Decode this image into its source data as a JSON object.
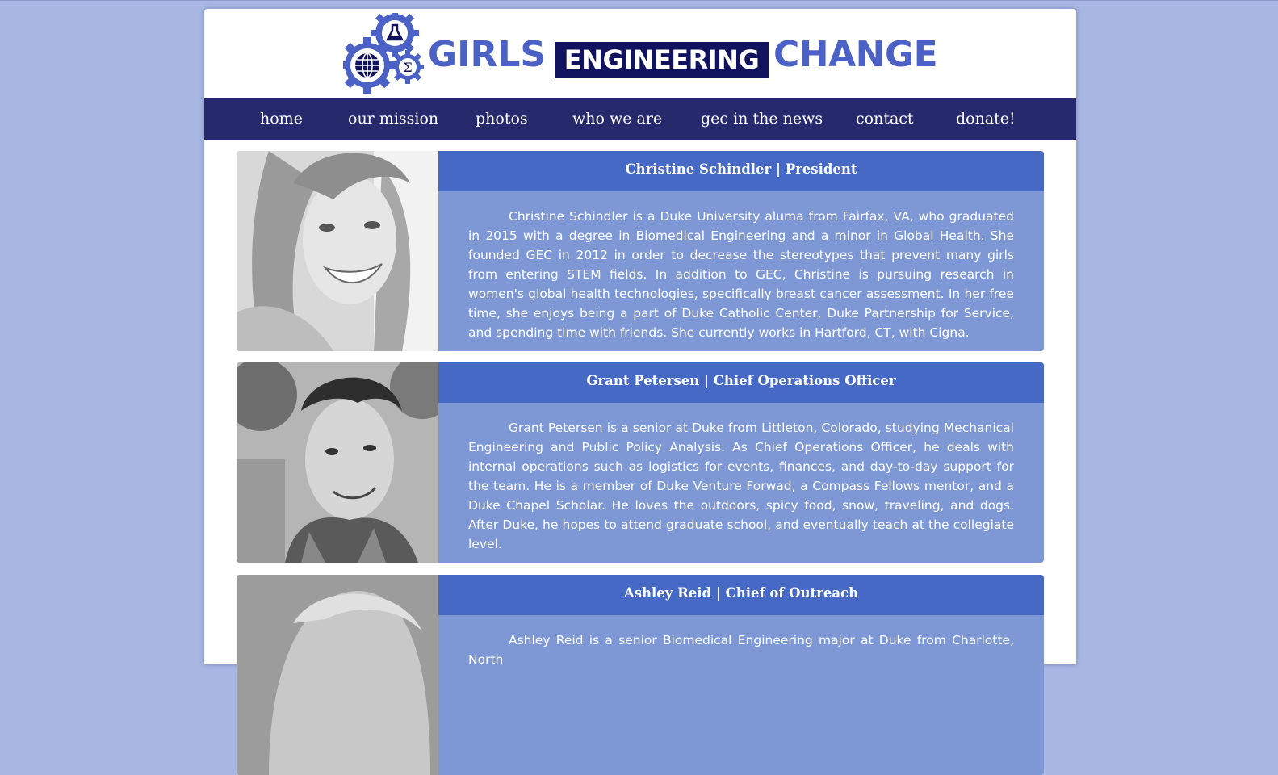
{
  "site": {
    "logo": {
      "word1": "GIRLS",
      "word2": "ENGINEERING",
      "word3": "CHANGE",
      "icon": "gears-logo-icon"
    },
    "colors": {
      "background": "#a8b6e2",
      "nav": "#26296b",
      "logo_blue": "#4b61c6",
      "logo_navy": "#12135e",
      "card_header": "#4769c6",
      "card_body": "#7e98d6"
    }
  },
  "nav": {
    "items": [
      {
        "label": "home"
      },
      {
        "label": "our mission"
      },
      {
        "label": "photos"
      },
      {
        "label": "who we are"
      },
      {
        "label": "gec in the news"
      },
      {
        "label": "contact"
      },
      {
        "label": "donate!"
      }
    ]
  },
  "members": [
    {
      "title": "Christine Schindler | President",
      "bio": "Christine Schindler is a Duke University aluma from Fairfax, VA, who graduated in 2015 with a degree in Biomedical Engineering and a minor in Global Health. She founded GEC in 2012 in order to decrease the stereotypes that prevent many girls from entering STEM fields. In addition to GEC, Christine is pursuing research in women's global health technologies, specifically breast cancer assessment. In her free time, she enjoys being a part of Duke Catholic Center, Duke Partnership for Service, and spending time with friends. She currently works in Hartford, CT, with Cigna."
    },
    {
      "title": "Grant Petersen | Chief Operations Officer",
      "bio": "Grant Petersen is a senior at Duke from Littleton, Colorado, studying Mechanical Engineering and Public Policy Analysis. As Chief Operations Officer, he deals with internal operations such as logistics for events, finances, and day-to-day support for the team. He is a member of Duke Venture Forwad, a Compass Fellows mentor, and a Duke Chapel Scholar. He loves the outdoors, spicy food, snow, traveling, and dogs. After Duke, he hopes to attend graduate school, and eventually teach at the collegiate level."
    },
    {
      "title": "Ashley Reid | Chief of Outreach",
      "bio": "Ashley Reid is a senior Biomedical Engineering major at Duke from Charlotte, North"
    }
  ]
}
